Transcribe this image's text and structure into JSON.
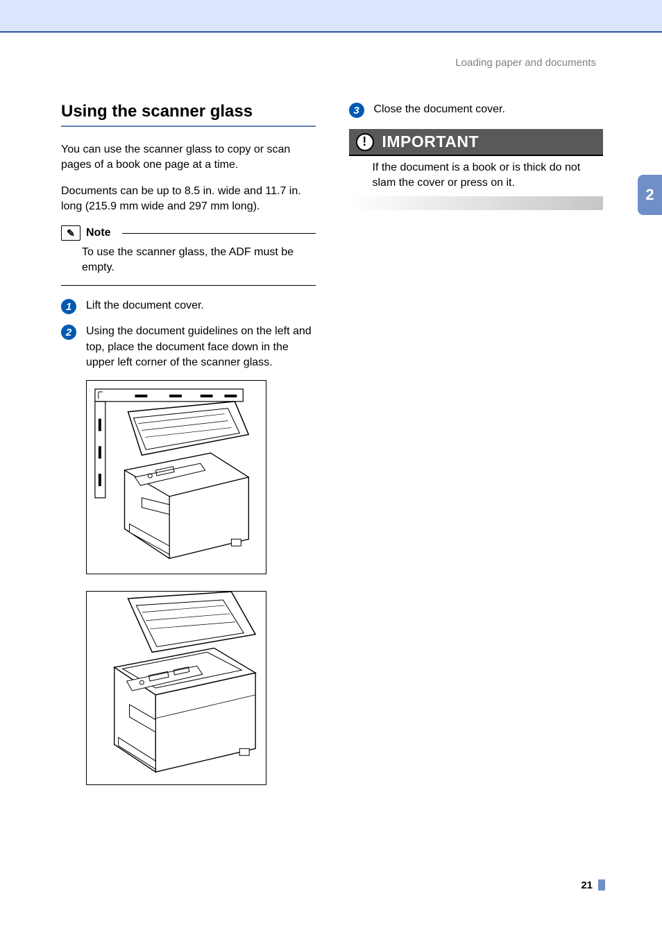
{
  "header": {
    "breadcrumb": "Loading paper and documents",
    "chapter_number": "2"
  },
  "left_column": {
    "section_title": "Using the scanner glass",
    "intro_para_1": "You can use the scanner glass to copy or scan pages of a book one page at a time.",
    "intro_para_2": "Documents can be up to 8.5 in. wide and 11.7 in. long (215.9 mm wide and 297 mm long).",
    "note": {
      "label": "Note",
      "body": "To use the scanner glass, the ADF must be empty."
    },
    "steps": {
      "s1": {
        "num": "1",
        "text": "Lift the document cover."
      },
      "s2": {
        "num": "2",
        "text": "Using the document guidelines on the left and top, place the document face down in the upper left corner of the scanner glass."
      }
    }
  },
  "right_column": {
    "steps": {
      "s3": {
        "num": "3",
        "text": "Close the document cover."
      }
    },
    "important": {
      "label": "IMPORTANT",
      "body": "If the document is a book or is thick do not slam the cover or press on it."
    }
  },
  "footer": {
    "page_number": "21"
  }
}
